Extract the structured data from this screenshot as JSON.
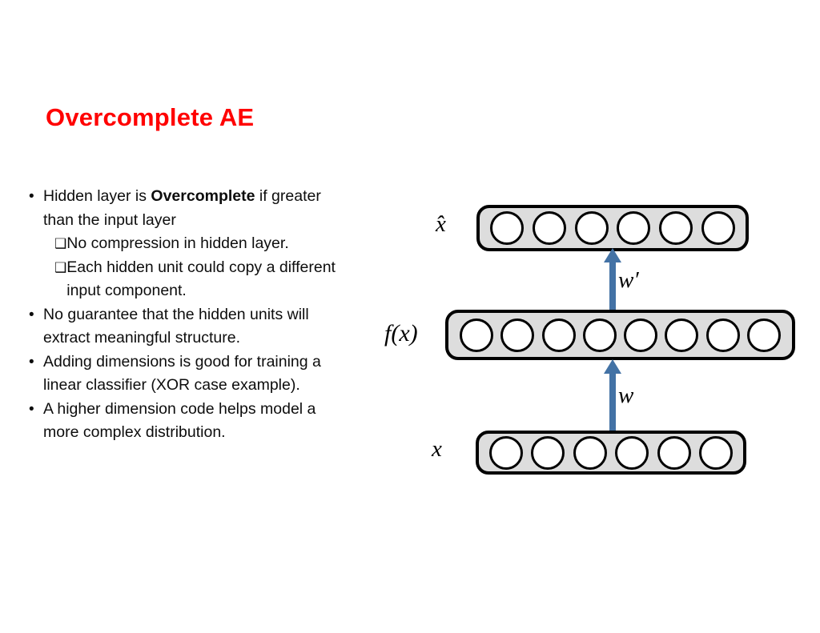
{
  "slide": {
    "title": "Overcomplete AE",
    "title_color": "#ff0000",
    "background_color": "#ffffff"
  },
  "bullets": [
    {
      "level": 1,
      "marker": "bullet-dot",
      "text_before_bold": "Hidden layer is ",
      "bold": "Overcomplete",
      "text_after_bold": " if greater than the input layer"
    },
    {
      "level": 2,
      "marker": "hollow-square",
      "text_before_bold": "No compression in hidden layer.",
      "bold": "",
      "text_after_bold": ""
    },
    {
      "level": 2,
      "marker": "hollow-square",
      "text_before_bold": "Each hidden unit could copy a different input component.",
      "bold": "",
      "text_after_bold": ""
    },
    {
      "level": 1,
      "marker": "bullet-dot",
      "text_before_bold": "No guarantee that the hidden units will extract meaningful structure.",
      "bold": "",
      "text_after_bold": ""
    },
    {
      "level": 1,
      "marker": "bullet-dot",
      "text_before_bold": "Adding dimensions is good for training a linear classifier (XOR case example).",
      "bold": "",
      "text_after_bold": ""
    },
    {
      "level": 1,
      "marker": "bullet-dot",
      "text_before_bold": "A higher dimension code helps model a more complex distribution.",
      "bold": "",
      "text_after_bold": ""
    }
  ],
  "markers": {
    "dot": "•",
    "square": "❑"
  },
  "diagram": {
    "node_fill": "#ffffff",
    "node_stroke": "#000000",
    "layer_fill": "#dddddd",
    "layer_stroke": "#000000",
    "arrow_color": "#4372a5",
    "layers": [
      {
        "name": "output-layer",
        "label": "̂x",
        "label_plain": "x-hat",
        "node_count": 6
      },
      {
        "name": "hidden-layer",
        "label": "f(x)",
        "label_plain": "f(x)",
        "node_count": 8
      },
      {
        "name": "input-layer",
        "label": "x",
        "label_plain": "x",
        "node_count": 6
      }
    ],
    "arrows": [
      {
        "name": "decoder-arrow",
        "label": "w′",
        "direction": "up",
        "from": "hidden-layer",
        "to": "output-layer"
      },
      {
        "name": "encoder-arrow",
        "label": "w",
        "direction": "up",
        "from": "input-layer",
        "to": "hidden-layer"
      }
    ]
  }
}
